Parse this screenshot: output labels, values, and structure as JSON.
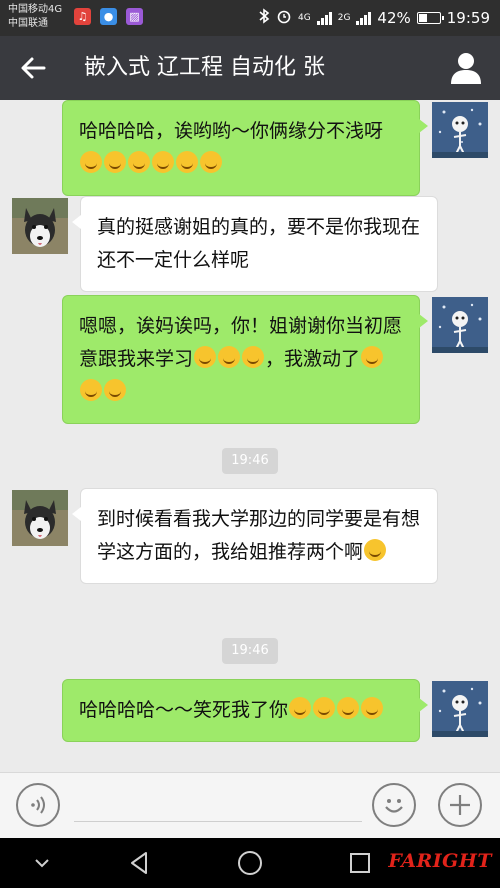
{
  "status_bar": {
    "carrier_1": "中国移动4G",
    "carrier_2": "中国联通",
    "net_1": "4G",
    "net_2": "2G",
    "battery_text": "42%",
    "battery_level": 0.42,
    "time": "19:59"
  },
  "header": {
    "back_icon": "arrow-left-icon",
    "title": "嵌入式 辽工程 自动化 张",
    "profile_icon": "person-icon"
  },
  "messages": [
    {
      "sender": "me",
      "text": "哈哈哈哈，诶哟哟～你俩缘分不浅呀",
      "emoji": [
        "smirk",
        "smirk",
        "smirk",
        "joy",
        "joy",
        "joy"
      ]
    },
    {
      "sender": "them",
      "text": "真的挺感谢姐的真的，要不是你我现在还不一定什么样呢"
    },
    {
      "sender": "me",
      "text_1": "嗯嗯，诶妈诶吗，你！姐谢谢你当初愿意跟我来学习",
      "emoji_1": [
        "sob",
        "sob",
        "sob"
      ],
      "text_2": "，我激动了",
      "emoji_2": [
        "sob",
        "sob",
        "sob"
      ]
    },
    {
      "sender": "them",
      "text": "到时候看看我大学那边的同学要是有想学这方面的，我给姐推荐两个啊",
      "emoji": [
        "joy"
      ]
    },
    {
      "sender": "me",
      "text": "哈哈哈哈～～笑死我了你",
      "emoji": [
        "rofl",
        "rofl",
        "rofl",
        "rofl"
      ]
    }
  ],
  "timestamps": [
    "19:46",
    "19:46"
  ],
  "input_bar": {
    "voice_icon": "voice-icon",
    "emoji_icon": "emoji-icon",
    "add_icon": "plus-icon"
  },
  "nav_bar": {
    "back_icon": "triangle-back-icon",
    "home_icon": "circle-home-icon",
    "recents_icon": "square-recents-icon",
    "watermark": "FARIGHT"
  },
  "colors": {
    "sent_bubble": "#9eea6a",
    "received_bubble": "#ffffff",
    "chat_background": "#ebebeb",
    "title_bar": "#393a3f"
  }
}
